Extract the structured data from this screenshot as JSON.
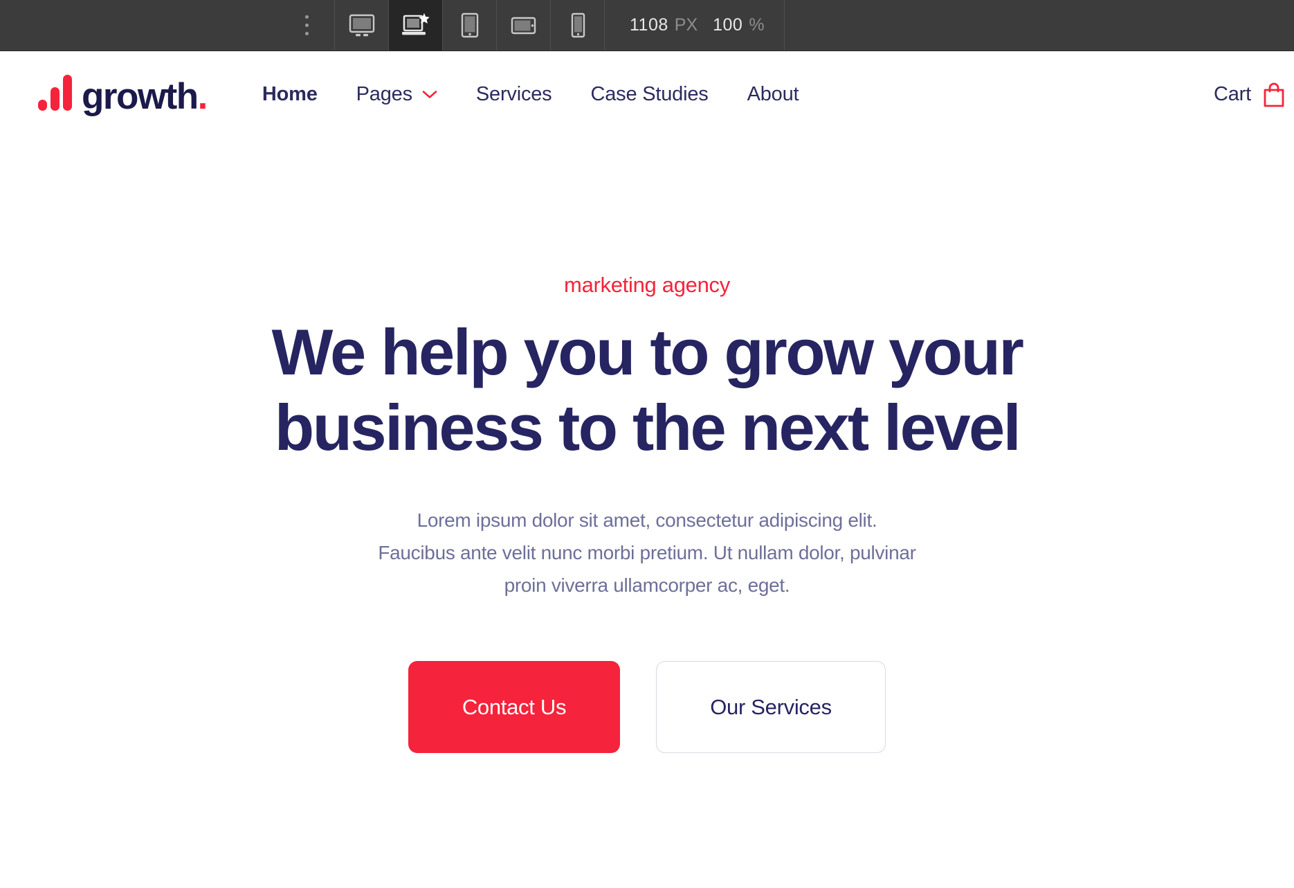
{
  "toolbar": {
    "kebab_icon": "more-vertical-icon",
    "devices": [
      {
        "id": "desktop",
        "icon": "desktop-monitor-icon",
        "label": "Desktop",
        "active": false
      },
      {
        "id": "laptop",
        "icon": "laptop-star-icon",
        "label": "Laptop",
        "active": true
      },
      {
        "id": "tablet-portrait",
        "icon": "tablet-portrait-icon",
        "label": "Tablet Portrait",
        "active": false
      },
      {
        "id": "tablet-landscape",
        "icon": "tablet-landscape-icon",
        "label": "Tablet Landscape",
        "active": false
      },
      {
        "id": "mobile",
        "icon": "mobile-phone-icon",
        "label": "Mobile",
        "active": false
      }
    ],
    "width_value": "1108",
    "width_unit": "PX",
    "zoom_value": "100",
    "zoom_unit": "%"
  },
  "header": {
    "brand": {
      "name": "growth",
      "dot": ".",
      "logo_icon": "bar-chart-logo-icon"
    },
    "nav": [
      {
        "label": "Home",
        "active": true,
        "has_dropdown": false
      },
      {
        "label": "Pages",
        "active": false,
        "has_dropdown": true,
        "dropdown_icon": "chevron-down-icon"
      },
      {
        "label": "Services",
        "active": false,
        "has_dropdown": false
      },
      {
        "label": "Case Studies",
        "active": false,
        "has_dropdown": false
      },
      {
        "label": "About",
        "active": false,
        "has_dropdown": false
      }
    ],
    "cart": {
      "label": "Cart",
      "icon": "shopping-bag-icon"
    }
  },
  "hero": {
    "eyebrow": "marketing agency",
    "title_line1": "We help you to grow your",
    "title_line2": "business to the next level",
    "paragraph_line1": "Lorem ipsum dolor sit amet, consectetur adipiscing elit.",
    "paragraph_line2": "Faucibus ante velit nunc morbi pretium. Ut nullam dolor, pulvinar",
    "paragraph_line3": "proin viverra ullamcorper ac, eget.",
    "primary_cta": "Contact Us",
    "secondary_cta": "Our Services"
  },
  "colors": {
    "accent_red": "#f5233b",
    "navy": "#262461",
    "muted_text": "#6d6f99",
    "toolbar_bg": "#3c3c3c",
    "toolbar_active_bg": "#262626"
  }
}
